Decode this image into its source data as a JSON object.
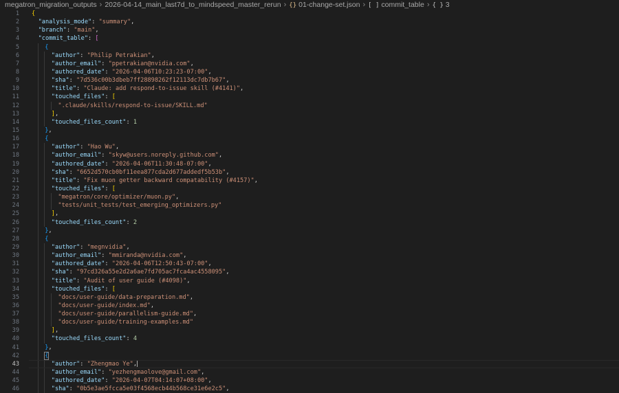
{
  "breadcrumb": [
    {
      "label": "megatron_migration_outputs",
      "icon": ""
    },
    {
      "label": "2026-04-14_main_last7d_to_mindspeed_master_rerun",
      "icon": ""
    },
    {
      "label": "01-change-set.json",
      "icon": "json-braces-icon"
    },
    {
      "label": "commit_table",
      "icon": "array-brackets-icon"
    },
    {
      "label": "3",
      "icon": "object-braces-icon"
    }
  ],
  "current_line": 43,
  "lines": [
    {
      "n": 1,
      "i": 0,
      "t": [
        [
          "b1",
          "{"
        ]
      ]
    },
    {
      "n": 2,
      "i": 1,
      "t": [
        [
          "k",
          "\"analysis_mode\""
        ],
        [
          "p",
          ": "
        ],
        [
          "s",
          "\"summary\""
        ],
        [
          "p",
          ","
        ]
      ]
    },
    {
      "n": 3,
      "i": 1,
      "t": [
        [
          "k",
          "\"branch\""
        ],
        [
          "p",
          ": "
        ],
        [
          "s",
          "\"main\""
        ],
        [
          "p",
          ","
        ]
      ]
    },
    {
      "n": 4,
      "i": 1,
      "t": [
        [
          "k",
          "\"commit_table\""
        ],
        [
          "p",
          ": "
        ],
        [
          "b2",
          "["
        ]
      ]
    },
    {
      "n": 5,
      "i": 2,
      "t": [
        [
          "b3",
          "{"
        ]
      ]
    },
    {
      "n": 6,
      "i": 3,
      "t": [
        [
          "k",
          "\"author\""
        ],
        [
          "p",
          ": "
        ],
        [
          "s",
          "\"Philip Petrakian\""
        ],
        [
          "p",
          ","
        ]
      ]
    },
    {
      "n": 7,
      "i": 3,
      "t": [
        [
          "k",
          "\"author_email\""
        ],
        [
          "p",
          ": "
        ],
        [
          "s",
          "\"ppetrakian@nvidia.com\""
        ],
        [
          "p",
          ","
        ]
      ]
    },
    {
      "n": 8,
      "i": 3,
      "t": [
        [
          "k",
          "\"authored_date\""
        ],
        [
          "p",
          ": "
        ],
        [
          "s",
          "\"2026-04-06T10:23:23-07:00\""
        ],
        [
          "p",
          ","
        ]
      ]
    },
    {
      "n": 9,
      "i": 3,
      "t": [
        [
          "k",
          "\"sha\""
        ],
        [
          "p",
          ": "
        ],
        [
          "s",
          "\"7d536c00b3dbeb7ff28898262f12113dc7db7b67\""
        ],
        [
          "p",
          ","
        ]
      ]
    },
    {
      "n": 10,
      "i": 3,
      "t": [
        [
          "k",
          "\"title\""
        ],
        [
          "p",
          ": "
        ],
        [
          "s",
          "\"Claude: add respond-to-issue skill (#4141)\""
        ],
        [
          "p",
          ","
        ]
      ]
    },
    {
      "n": 11,
      "i": 3,
      "t": [
        [
          "k",
          "\"touched_files\""
        ],
        [
          "p",
          ": "
        ],
        [
          "b1",
          "["
        ]
      ]
    },
    {
      "n": 12,
      "i": 4,
      "t": [
        [
          "s",
          "\".claude/skills/respond-to-issue/SKILL.md\""
        ]
      ]
    },
    {
      "n": 13,
      "i": 3,
      "t": [
        [
          "b1",
          "]"
        ],
        [
          "p",
          ","
        ]
      ]
    },
    {
      "n": 14,
      "i": 3,
      "t": [
        [
          "k",
          "\"touched_files_count\""
        ],
        [
          "p",
          ": "
        ],
        [
          "n",
          "1"
        ]
      ]
    },
    {
      "n": 15,
      "i": 2,
      "t": [
        [
          "b3",
          "}"
        ],
        [
          "p",
          ","
        ]
      ]
    },
    {
      "n": 16,
      "i": 2,
      "t": [
        [
          "b3",
          "{"
        ]
      ]
    },
    {
      "n": 17,
      "i": 3,
      "t": [
        [
          "k",
          "\"author\""
        ],
        [
          "p",
          ": "
        ],
        [
          "s",
          "\"Hao Wu\""
        ],
        [
          "p",
          ","
        ]
      ]
    },
    {
      "n": 18,
      "i": 3,
      "t": [
        [
          "k",
          "\"author_email\""
        ],
        [
          "p",
          ": "
        ],
        [
          "s",
          "\"skyw@users.noreply.github.com\""
        ],
        [
          "p",
          ","
        ]
      ]
    },
    {
      "n": 19,
      "i": 3,
      "t": [
        [
          "k",
          "\"authored_date\""
        ],
        [
          "p",
          ": "
        ],
        [
          "s",
          "\"2026-04-06T11:30:48-07:00\""
        ],
        [
          "p",
          ","
        ]
      ]
    },
    {
      "n": 20,
      "i": 3,
      "t": [
        [
          "k",
          "\"sha\""
        ],
        [
          "p",
          ": "
        ],
        [
          "s",
          "\"6652d570cb0bf11eea877cda2d677addedf5b53b\""
        ],
        [
          "p",
          ","
        ]
      ]
    },
    {
      "n": 21,
      "i": 3,
      "t": [
        [
          "k",
          "\"title\""
        ],
        [
          "p",
          ": "
        ],
        [
          "s",
          "\"Fix muon getter backward compatability (#4157)\""
        ],
        [
          "p",
          ","
        ]
      ]
    },
    {
      "n": 22,
      "i": 3,
      "t": [
        [
          "k",
          "\"touched_files\""
        ],
        [
          "p",
          ": "
        ],
        [
          "b1",
          "["
        ]
      ]
    },
    {
      "n": 23,
      "i": 4,
      "t": [
        [
          "s",
          "\"megatron/core/optimizer/muon.py\""
        ],
        [
          "p",
          ","
        ]
      ]
    },
    {
      "n": 24,
      "i": 4,
      "t": [
        [
          "s",
          "\"tests/unit_tests/test_emerging_optimizers.py\""
        ]
      ]
    },
    {
      "n": 25,
      "i": 3,
      "t": [
        [
          "b1",
          "]"
        ],
        [
          "p",
          ","
        ]
      ]
    },
    {
      "n": 26,
      "i": 3,
      "t": [
        [
          "k",
          "\"touched_files_count\""
        ],
        [
          "p",
          ": "
        ],
        [
          "n",
          "2"
        ]
      ]
    },
    {
      "n": 27,
      "i": 2,
      "t": [
        [
          "b3",
          "}"
        ],
        [
          "p",
          ","
        ]
      ]
    },
    {
      "n": 28,
      "i": 2,
      "t": [
        [
          "b3",
          "{"
        ]
      ]
    },
    {
      "n": 29,
      "i": 3,
      "t": [
        [
          "k",
          "\"author\""
        ],
        [
          "p",
          ": "
        ],
        [
          "s",
          "\"megnvidia\""
        ],
        [
          "p",
          ","
        ]
      ]
    },
    {
      "n": 30,
      "i": 3,
      "t": [
        [
          "k",
          "\"author_email\""
        ],
        [
          "p",
          ": "
        ],
        [
          "s",
          "\"mmiranda@nvidia.com\""
        ],
        [
          "p",
          ","
        ]
      ]
    },
    {
      "n": 31,
      "i": 3,
      "t": [
        [
          "k",
          "\"authored_date\""
        ],
        [
          "p",
          ": "
        ],
        [
          "s",
          "\"2026-04-06T12:50:43-07:00\""
        ],
        [
          "p",
          ","
        ]
      ]
    },
    {
      "n": 32,
      "i": 3,
      "t": [
        [
          "k",
          "\"sha\""
        ],
        [
          "p",
          ": "
        ],
        [
          "s",
          "\"97cd326a55e2d2a6ae7fd705ac7fca4ac4558095\""
        ],
        [
          "p",
          ","
        ]
      ]
    },
    {
      "n": 33,
      "i": 3,
      "t": [
        [
          "k",
          "\"title\""
        ],
        [
          "p",
          ": "
        ],
        [
          "s",
          "\"Audit of user guide (#4098)\""
        ],
        [
          "p",
          ","
        ]
      ]
    },
    {
      "n": 34,
      "i": 3,
      "t": [
        [
          "k",
          "\"touched_files\""
        ],
        [
          "p",
          ": "
        ],
        [
          "b1",
          "["
        ]
      ]
    },
    {
      "n": 35,
      "i": 4,
      "t": [
        [
          "s",
          "\"docs/user-guide/data-preparation.md\""
        ],
        [
          "p",
          ","
        ]
      ]
    },
    {
      "n": 36,
      "i": 4,
      "t": [
        [
          "s",
          "\"docs/user-guide/index.md\""
        ],
        [
          "p",
          ","
        ]
      ]
    },
    {
      "n": 37,
      "i": 4,
      "t": [
        [
          "s",
          "\"docs/user-guide/parallelism-guide.md\""
        ],
        [
          "p",
          ","
        ]
      ]
    },
    {
      "n": 38,
      "i": 4,
      "t": [
        [
          "s",
          "\"docs/user-guide/training-examples.md\""
        ]
      ]
    },
    {
      "n": 39,
      "i": 3,
      "t": [
        [
          "b1",
          "]"
        ],
        [
          "p",
          ","
        ]
      ]
    },
    {
      "n": 40,
      "i": 3,
      "t": [
        [
          "k",
          "\"touched_files_count\""
        ],
        [
          "p",
          ": "
        ],
        [
          "n",
          "4"
        ]
      ]
    },
    {
      "n": 41,
      "i": 2,
      "t": [
        [
          "b3",
          "}"
        ],
        [
          "p",
          ","
        ]
      ]
    },
    {
      "n": 42,
      "i": 2,
      "t": [
        [
          "b3",
          "{"
        ]
      ]
    },
    {
      "n": 43,
      "i": 3,
      "t": [
        [
          "k",
          "\"author\""
        ],
        [
          "p",
          ": "
        ],
        [
          "s",
          "\"Zhengmao Ye\""
        ],
        [
          "p",
          ","
        ]
      ]
    },
    {
      "n": 44,
      "i": 3,
      "t": [
        [
          "k",
          "\"author_email\""
        ],
        [
          "p",
          ": "
        ],
        [
          "s",
          "\"yezhengmaolove@gmail.com\""
        ],
        [
          "p",
          ","
        ]
      ]
    },
    {
      "n": 45,
      "i": 3,
      "t": [
        [
          "k",
          "\"authored_date\""
        ],
        [
          "p",
          ": "
        ],
        [
          "s",
          "\"2026-04-07T04:14:07+08:00\""
        ],
        [
          "p",
          ","
        ]
      ]
    },
    {
      "n": 46,
      "i": 3,
      "t": [
        [
          "k",
          "\"sha\""
        ],
        [
          "p",
          ": "
        ],
        [
          "s",
          "\"0b5e3ae5fcca5e03f4568ecb44b568ce31e6e2c5\""
        ],
        [
          "p",
          ","
        ]
      ]
    }
  ],
  "colors": {
    "background": "#1e1e1e",
    "key": "#9cdcfe",
    "string": "#ce9178",
    "number": "#b5cea8",
    "bracket_level1": "#ffd700",
    "bracket_level2": "#da70d6",
    "bracket_level3": "#179fff"
  }
}
